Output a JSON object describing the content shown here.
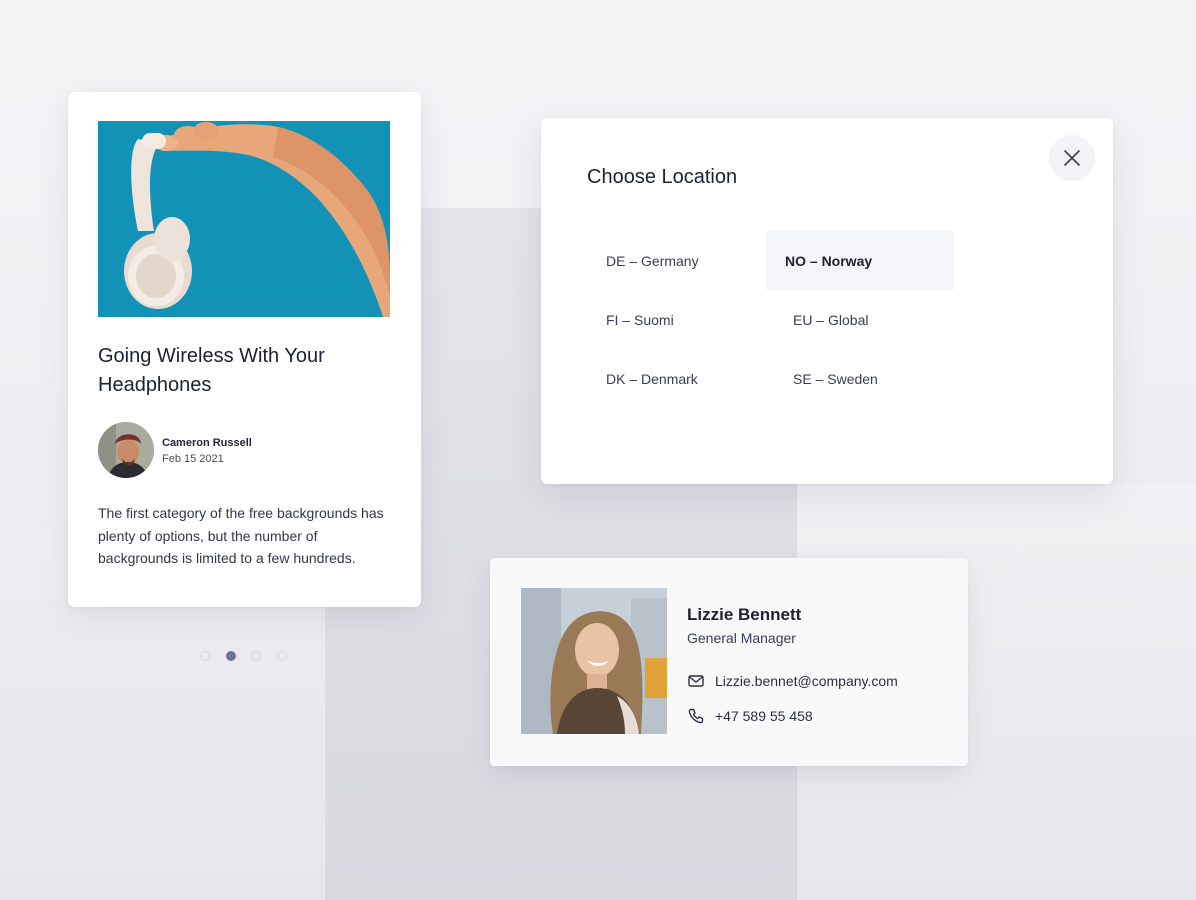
{
  "article": {
    "title": "Going Wireless With Your Headphones",
    "author_name": "Cameron Russell",
    "author_date": "Feb 15 2021",
    "body": "The first category of the free backgrounds has plenty of options, but the number of backgrounds is limited to a few hundreds.",
    "image_icon": "headphones-photo",
    "image_bg_color": "#1392b8"
  },
  "pager": {
    "total": 4,
    "active_index": 1
  },
  "location_dialog": {
    "title": "Choose Location",
    "close_icon": "close-icon",
    "locations": [
      {
        "label": "DE – Germany",
        "selected": false
      },
      {
        "label": "NO – Norway",
        "selected": true
      },
      {
        "label": "FI – Suomi",
        "selected": false
      },
      {
        "label": "EU – Global",
        "selected": false
      },
      {
        "label": "DK – Denmark",
        "selected": false
      },
      {
        "label": "SE – Sweden",
        "selected": false
      }
    ]
  },
  "contact": {
    "name": "Lizzie Bennett",
    "role": "General Manager",
    "email": "Lizzie.bennet@company.com",
    "phone": "+47 589 55 458",
    "email_icon": "mail-icon",
    "phone_icon": "phone-icon"
  },
  "colors": {
    "accent": "#6d7397",
    "selected_bg": "#f4f5f8"
  }
}
